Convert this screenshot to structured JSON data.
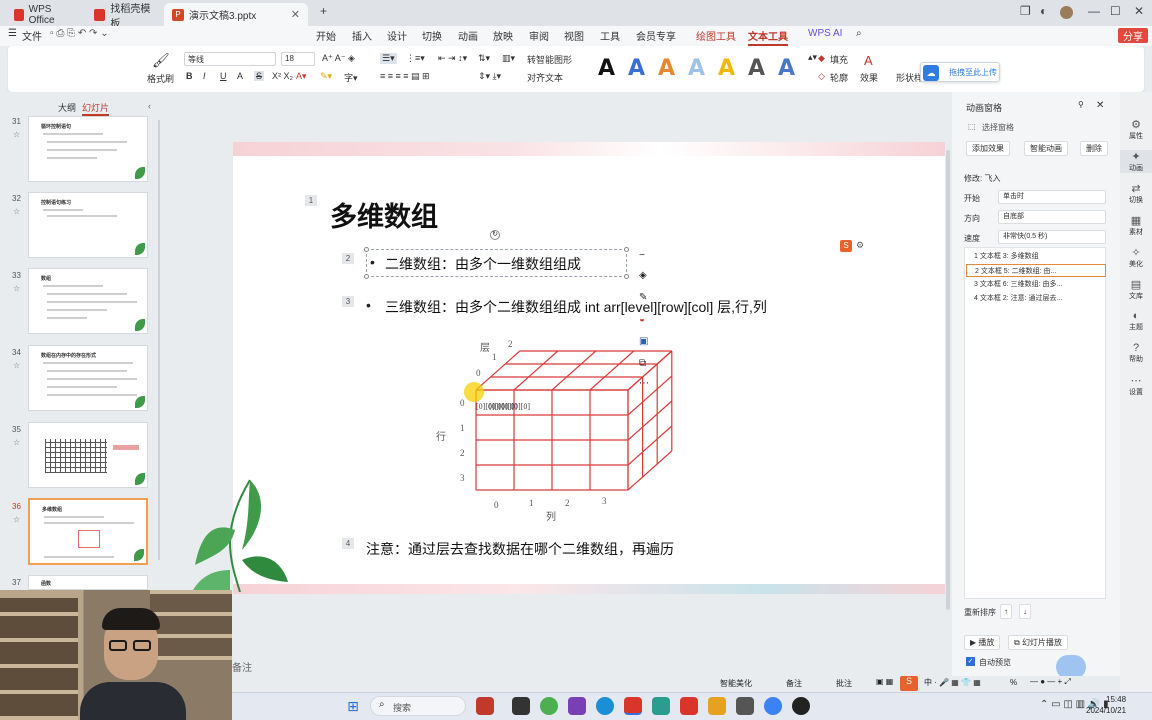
{
  "titlebar": {
    "tabs": [
      {
        "label": "WPS Office",
        "color": "#d9352b"
      },
      {
        "label": "找稻壳模板",
        "color": "#d9352b"
      },
      {
        "label": "演示文稿3.pptx",
        "color": "#d24726"
      }
    ],
    "new_tab": "+"
  },
  "menubar": {
    "file": "文件",
    "items": [
      "开始",
      "插入",
      "设计",
      "切换",
      "动画",
      "放映",
      "审阅",
      "视图",
      "工具",
      "会员专享",
      "绘图工具",
      "文本工具"
    ],
    "ai": "WPS AI",
    "share": "分享"
  },
  "ribbon": {
    "format_painter": "格式刷",
    "font_name": "等线",
    "font_size": "18",
    "bold": "B",
    "italic": "I",
    "underline": "U",
    "strike": "S",
    "smart_graphic": "转智能图形",
    "align_text": "对齐文本",
    "fill": "填充",
    "outline": "轮廓",
    "effects": "效果",
    "shape_style": "形状样",
    "upload_tip": "拖拽至此上传",
    "big_a_colors": [
      "#111111",
      "#3a6fd8",
      "#e8872e",
      "#9fc3e8",
      "#f2b705",
      "#555555",
      "#4a78c9"
    ]
  },
  "left_panel": {
    "tab_outline": "大纲",
    "tab_slides": "幻灯片",
    "thumbs": [
      {
        "num": "31",
        "title": "循环控制语句"
      },
      {
        "num": "32",
        "title": "控制语句练习"
      },
      {
        "num": "33",
        "title": "数组"
      },
      {
        "num": "34",
        "title": "数组在内存中的存在形式"
      },
      {
        "num": "35",
        "title": ""
      },
      {
        "num": "36",
        "title": "多维数组"
      },
      {
        "num": "37",
        "title": "函数"
      }
    ]
  },
  "slide": {
    "title": "多维数组",
    "bullet1": "二维数组：由多个一维数组组成",
    "bullet2": "三维数组：由多个二维数组组成 int arr[level][row][col]  层,行,列",
    "note": "注意：通过层去查找数据在哪个二维数组，再遍历",
    "tags": [
      "1",
      "2",
      "3",
      "4"
    ],
    "diagram": {
      "layer_label": "层",
      "row_label": "行",
      "col_label": "列",
      "layers": [
        "0",
        "1",
        "2"
      ],
      "rows": [
        "0",
        "1",
        "2",
        "3"
      ],
      "cols": [
        "0",
        "1",
        "2",
        "3"
      ],
      "cell": "[0][0][0]",
      "grid_color": "#d93a3a"
    }
  },
  "anim_panel": {
    "title": "动画窗格",
    "select_pane": "选择窗格",
    "add_effect": "添加效果",
    "smart_anim": "智能动画",
    "delete": "删除",
    "modify": "修改: 飞入",
    "start_label": "开始",
    "start_value": "单击时",
    "direction_label": "方向",
    "direction_value": "自底部",
    "speed_label": "速度",
    "speed_value": "非常快(0.5 秒)",
    "items": [
      "1  文本框 3: 多维数组",
      "2  文本框 5: 二维数组: 由...",
      "3  文本框 6: 三维数组: 由多...",
      "4  文本框 2: 注意: 通过层去..."
    ],
    "reorder": "重新排序",
    "play": "播放",
    "slideshow": "幻灯片播放",
    "autopreview": "自动预览"
  },
  "side_tools": [
    "属性",
    "动画",
    "切换",
    "素材",
    "美化",
    "文库",
    "主题",
    "帮助",
    "设置"
  ],
  "notes": {
    "placeholder": "备注"
  },
  "status": {
    "smart_beautify": "智能美化",
    "comments": "备注",
    "annotate": "批注",
    "zoom": "%"
  },
  "taskbar": {
    "search": "搜索",
    "time": "15:48",
    "date": "2024/10/21"
  }
}
